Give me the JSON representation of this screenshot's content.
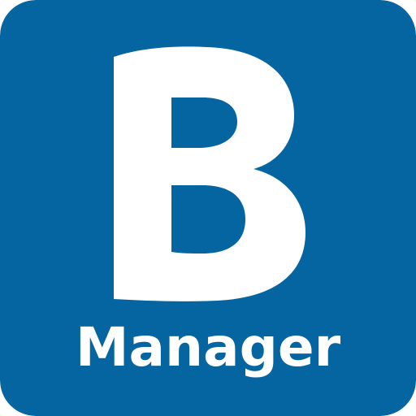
{
  "app_icon": {
    "letter": "B",
    "label": "Manager",
    "background_color": "#0565a0",
    "foreground_color": "#ffffff"
  }
}
